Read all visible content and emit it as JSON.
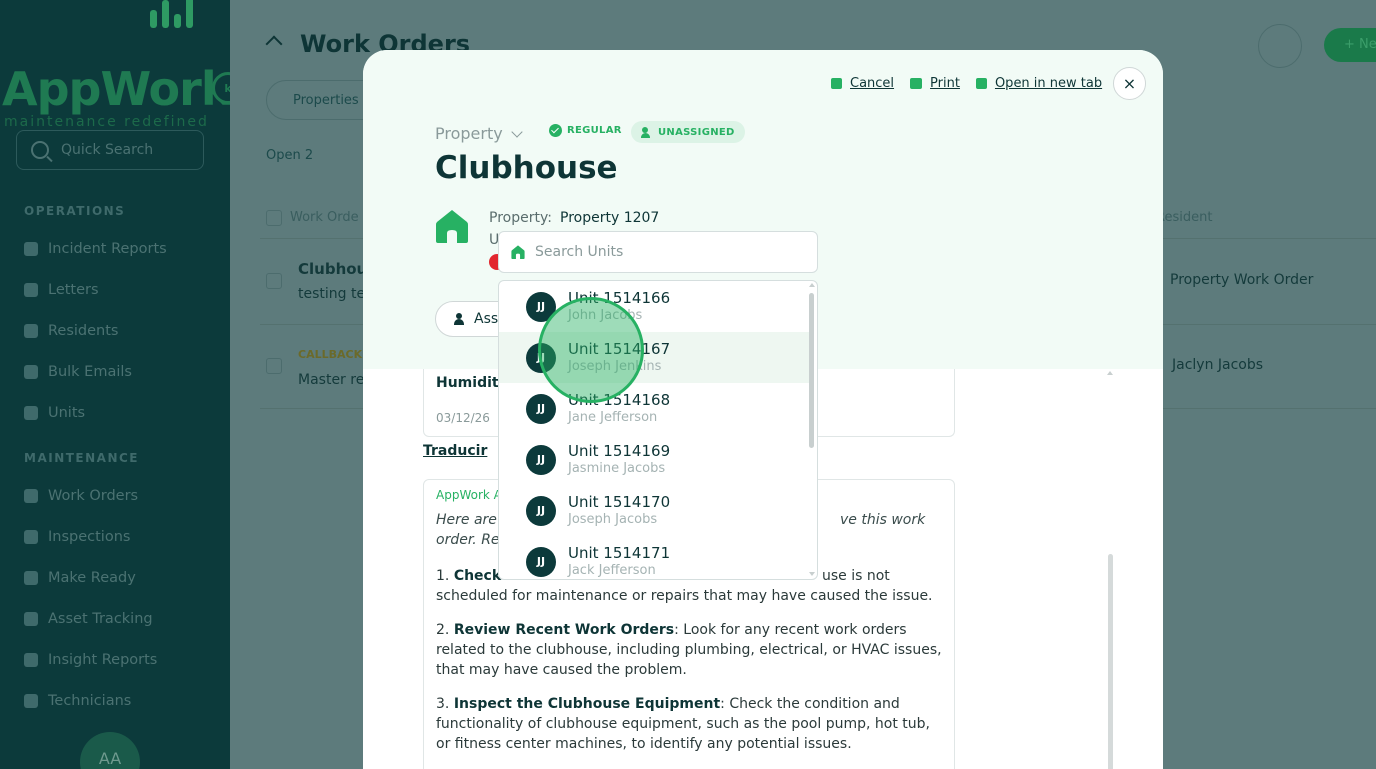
{
  "sidebar": {
    "logo_text": "AppWork",
    "logo_badge": "k",
    "logo_tagline": "maintenance redefined",
    "search_placeholder": "Quick Search",
    "section_operations": "OPERATIONS",
    "section_maintenance": "MAINTENANCE",
    "items": [
      {
        "label": "Incident Reports"
      },
      {
        "label": "Letters"
      },
      {
        "label": "Residents"
      },
      {
        "label": "Bulk Emails"
      },
      {
        "label": "Units"
      },
      {
        "label": "Work Orders"
      },
      {
        "label": "Inspections"
      },
      {
        "label": "Make Ready"
      },
      {
        "label": "Asset Tracking"
      },
      {
        "label": "Insight Reports"
      },
      {
        "label": "Technicians"
      }
    ],
    "avatar_initials": "AA"
  },
  "background": {
    "page_title": "Work Orders",
    "new_button": "+ New",
    "properties_pill": "Properties",
    "open_count": "Open 2",
    "col_work_order": "Work Orde",
    "col_resident": "Resident",
    "row1_title": "Clubhou",
    "row1_sub": "testing te",
    "row1_resident": "Property Work Order",
    "row2_tag": "CALLBACK",
    "row2_title": "Master re",
    "row2_resident": "Jaclyn Jacobs"
  },
  "modal": {
    "actions": {
      "cancel": "Cancel",
      "print": "Print",
      "open_new_tab": "Open in new tab"
    },
    "close_symbol": "×",
    "category": "Property",
    "badge_regular": "REGULAR",
    "badge_unassigned": "UNASSIGNED",
    "title": "Clubhouse",
    "property_label": "Property:",
    "property_value": "Property 1207",
    "unit_label_partial": "U",
    "assign_label": "Ass",
    "search": {
      "placeholder": "Search Units"
    },
    "units": [
      {
        "unit": "Unit 1514166",
        "resident": "John Jacobs",
        "initials": "JJ"
      },
      {
        "unit": "Unit 1514167",
        "resident": "Joseph Jenkins",
        "initials": "JJ"
      },
      {
        "unit": "Unit 1514168",
        "resident": "Jane Jefferson",
        "initials": "JJ"
      },
      {
        "unit": "Unit 1514169",
        "resident": "Jasmine Jacobs",
        "initials": "JJ"
      },
      {
        "unit": "Unit 1514170",
        "resident": "Joseph Jacobs",
        "initials": "JJ"
      },
      {
        "unit": "Unit 1514171",
        "resident": "Jack Jefferson",
        "initials": "JJ"
      }
    ],
    "body": {
      "card_title": "Humidity",
      "card_date": "03/12/26",
      "translate": "Traducir",
      "ai_label": "AppWork A",
      "ai_intro_a": "Here are",
      "ai_intro_b": "ve this work",
      "ai_intro_c": "order. Re",
      "step1_num": "1.",
      "step1_bold": "Check",
      "step1_tail": "use is not",
      "step1_line2": "scheduled for maintenance or repairs that may have caused the issue.",
      "step2_num": "2.",
      "step2_bold": "Review Recent Work Orders",
      "step2_text": ": Look for any recent work orders related to the clubhouse, including plumbing, electrical, or HVAC issues, that may have caused the problem.",
      "step3_num": "3.",
      "step3_bold": "Inspect the Clubhouse Equipment",
      "step3_text": ": Check the condition and functionality of clubhouse equipment, such as the pool pump, hot tub, or fitness center machines, to identify any potential issues."
    }
  },
  "colors": {
    "accent": "#27b163",
    "dark": "#0e3536",
    "sidebar": "#0c3a3b"
  }
}
